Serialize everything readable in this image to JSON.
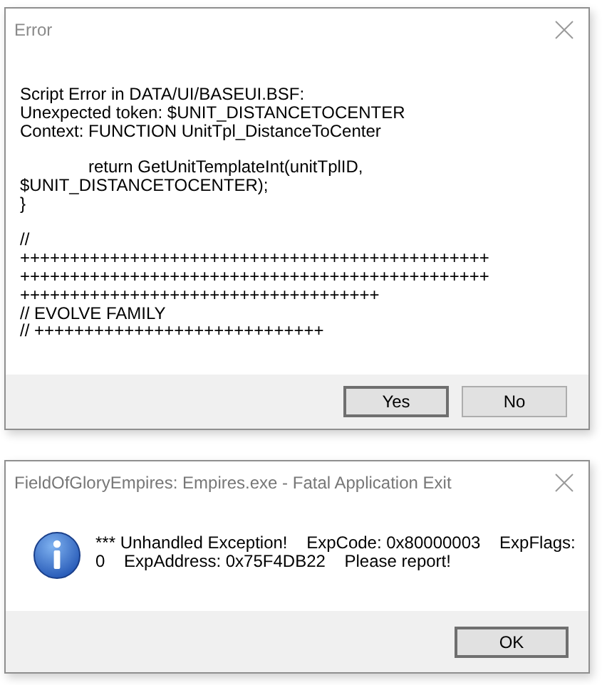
{
  "dialogs": [
    {
      "title": "Error",
      "message": "Script Error in DATA/UI/BASEUI.BSF:\nUnexpected token: $UNIT_DISTANCETOCENTER\nContext: FUNCTION UnitTpl_DistanceToCenter\n\n\treturn GetUnitTemplateInt(unitTplID,\n$UNIT_DISTANCETOCENTER);\n}\n\n//\n+++++++++++++++++++++++++++++++++++++++++++++++\n+++++++++++++++++++++++++++++++++++++++++++++++\n++++++++++++++++++++++++++++++++++++\n// EVOLVE FAMILY\n// +++++++++++++++++++++++++++++",
      "buttons": [
        {
          "label": "Yes",
          "default": true
        },
        {
          "label": "No",
          "default": false
        }
      ]
    },
    {
      "title": "FieldOfGloryEmpires: Empires.exe - Fatal Application Exit",
      "kind": "information",
      "message": "*** Unhandled Exception!    ExpCode: 0x80000003    ExpFlags:\n0    ExpAddress: 0x75F4DB22    Please report!",
      "buttons": [
        {
          "label": "OK",
          "default": true
        }
      ]
    }
  ]
}
